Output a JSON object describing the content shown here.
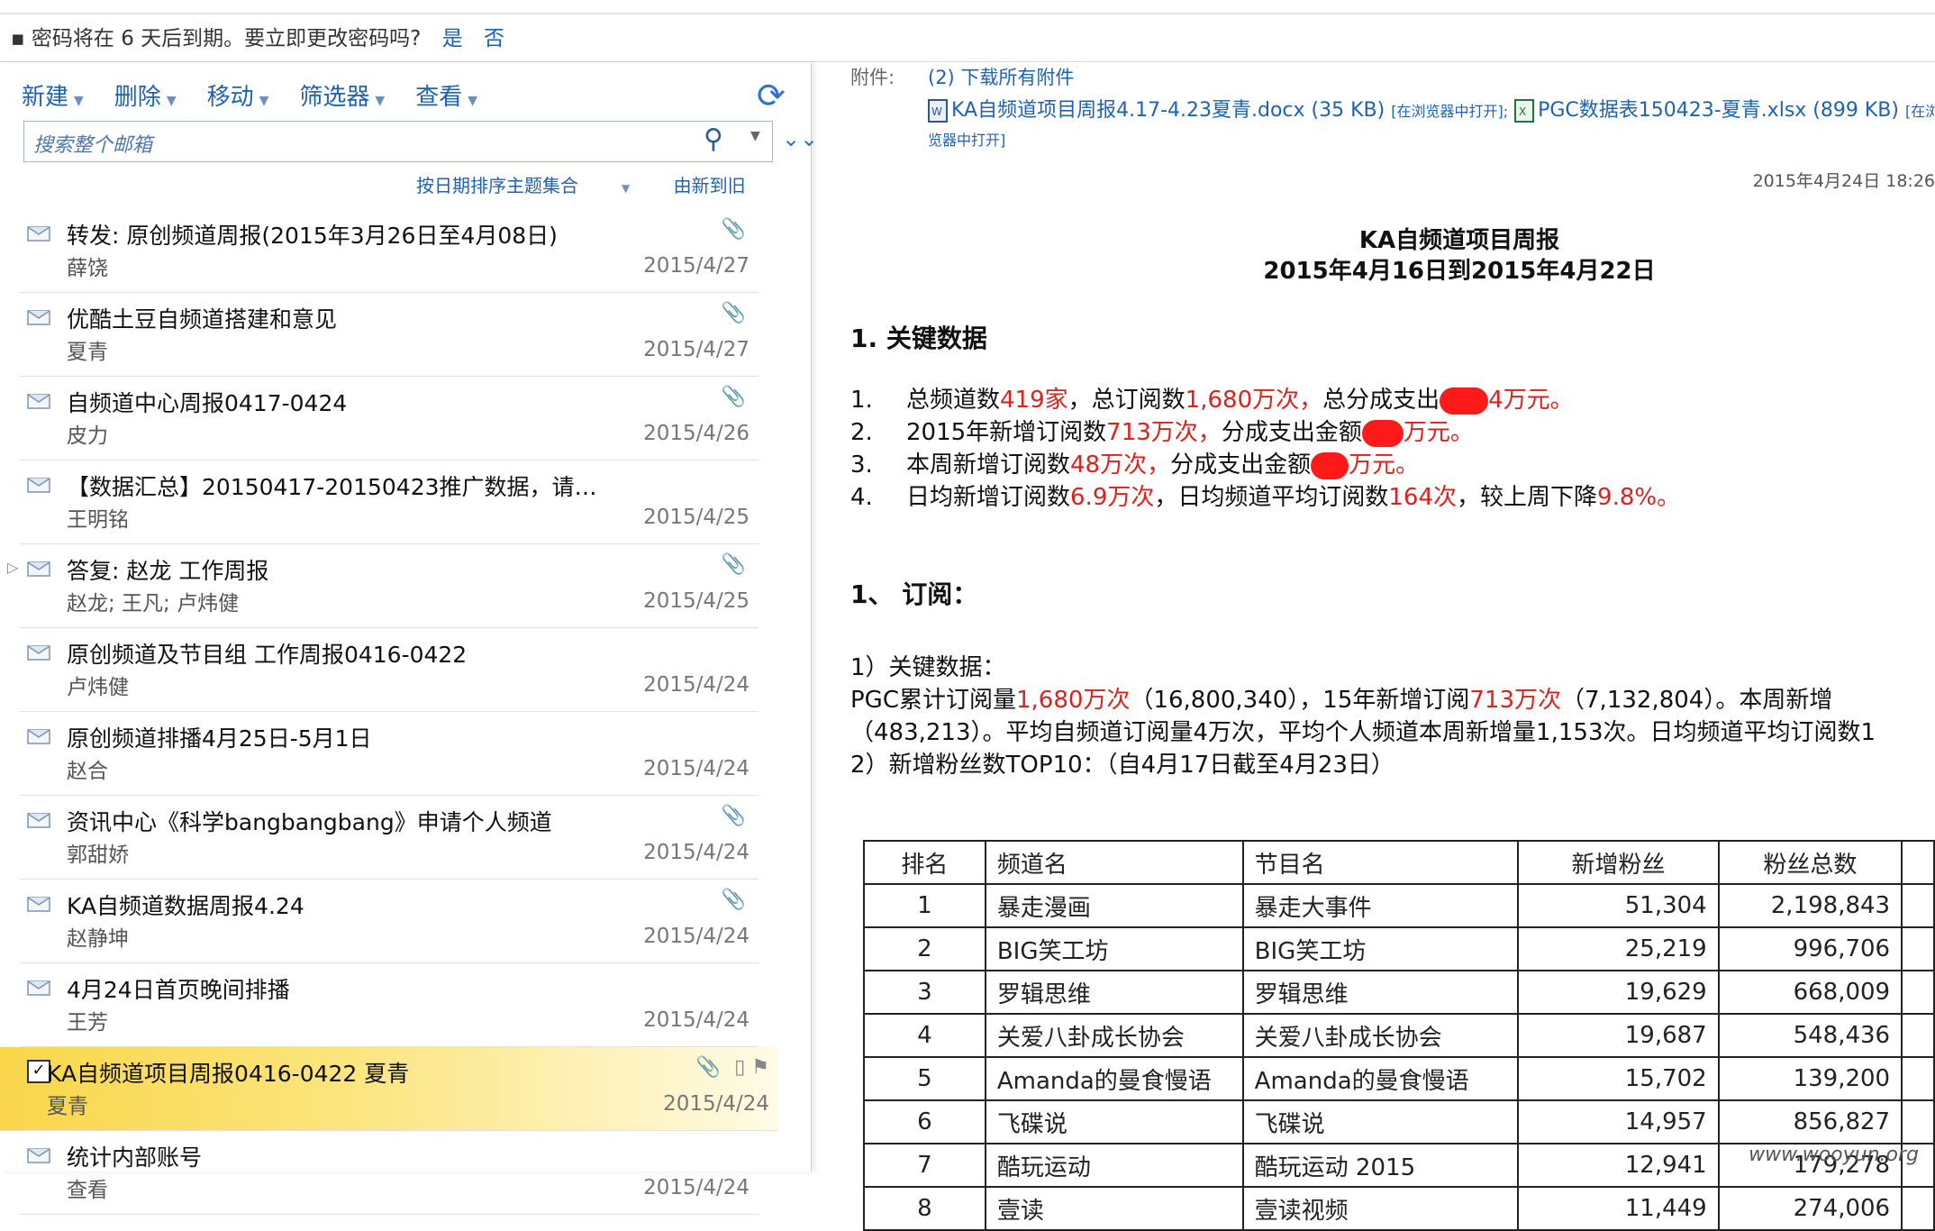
{
  "notice": {
    "text": "密码将在 6 天后到期。要立即更改密码吗?",
    "yes": "是",
    "no": "否"
  },
  "toolbar": {
    "new": "新建",
    "delete": "删除",
    "move": "移动",
    "filter": "筛选器",
    "view": "查看"
  },
  "search": {
    "placeholder": "搜索整个邮箱"
  },
  "sort": {
    "by": "按日期排序主题集合",
    "order": "由新到旧"
  },
  "messages": [
    {
      "subject": "转发: 原创频道周报(2015年3月26日至4月08日)",
      "from": "薛饶",
      "date": "2015/4/27",
      "attach": true
    },
    {
      "subject": "优酷土豆自频道搭建和意见",
      "from": "夏青",
      "date": "2015/4/27",
      "attach": true
    },
    {
      "subject": "自频道中心周报0417-0424",
      "from": "皮力",
      "date": "2015/4/26",
      "attach": true
    },
    {
      "subject": "【数据汇总】20150417-20150423推广数据，请…",
      "from": "王明铭",
      "date": "2015/4/25",
      "attach": false
    },
    {
      "subject": "答复: 赵龙 工作周报",
      "from": "赵龙; 王凡; 卢炜健",
      "date": "2015/4/25",
      "attach": true
    },
    {
      "subject": "原创频道及节目组 工作周报0416-0422",
      "from": "卢炜健",
      "date": "2015/4/24",
      "attach": false
    },
    {
      "subject": "原创频道排播4月25日-5月1日",
      "from": "赵合",
      "date": "2015/4/24",
      "attach": false
    },
    {
      "subject": "资讯中心《科学bangbangbang》申请个人频道",
      "from": "郭甜娇",
      "date": "2015/4/24",
      "attach": true
    },
    {
      "subject": "KA自频道数据周报4.24",
      "from": "赵静坤",
      "date": "2015/4/24",
      "attach": true
    },
    {
      "subject": "4月24日首页晚间排播",
      "from": "王芳",
      "date": "2015/4/24",
      "attach": false
    },
    {
      "subject": "KA自频道项目周报0416-0422 夏青",
      "from": "夏青",
      "date": "2015/4/24",
      "attach": true
    },
    {
      "subject": "统计内部账号",
      "from": "查看",
      "date": "2015/4/24",
      "attach": false
    }
  ],
  "attachments": {
    "label": "附件:",
    "count": "(2)  下载所有附件",
    "file1": "KA自频道项目周报4.17-4.23夏青.docx (35 KB)",
    "open1": "[在浏览器中打开];",
    "file2": "PGC数据表150423-夏青.xlsx (899 KB)",
    "open2a": "[在浏",
    "open2b": "览器中打开]"
  },
  "message_date": "2015年4月24日 18:26",
  "report": {
    "title": "KA自频道项目周报",
    "subtitle": "2015年4月16日到2015年4月22日",
    "h1": "1.   关键数据",
    "kd": [
      {
        "n": "1.",
        "a": "总频道数",
        "b": "419家",
        "c": "，总订阅数",
        "d": "1,680万次，",
        "e": "总分成支出",
        "f": "4万元。"
      },
      {
        "n": "2.",
        "a": "2015年新增订阅数",
        "b": "713万次，",
        "c": "分成支出金额",
        "d": "万元。"
      },
      {
        "n": "3.",
        "a": "本周新增订阅数",
        "b": "48万次，",
        "c": "分成支出金额",
        "d": "万元。"
      },
      {
        "n": "4.",
        "a": "日均新增订阅数",
        "b": "6.9万次",
        "c": "，日均频道平均订阅数",
        "d": "164次",
        "e": "，较上周下降",
        "f": "9.8%。"
      }
    ],
    "h2": "1、 订阅：",
    "p1": "1）关键数据：",
    "p2a": "PGC累计订阅量",
    "p2b": "1,680万次",
    "p2c": "（16,800,340），15年新增订阅",
    "p2d": "713万次",
    "p2e": "（7,132,804）。本周新增",
    "p3": "（483,213）。平均自频道订阅量4万次，平均个人频道本周新增量1,153次。日均频道平均订阅数1",
    "p4": "2）新增粉丝数TOP10：（自4月17日截至4月23日）"
  },
  "table": {
    "headers": [
      "排名",
      "频道名",
      "节目名",
      "新增粉丝",
      "粉丝总数"
    ],
    "rows": [
      [
        "1",
        "暴走漫画",
        "暴走大事件",
        "51,304",
        "2,198,843"
      ],
      [
        "2",
        "BIG笑工坊",
        "BIG笑工坊",
        "25,219",
        "996,706"
      ],
      [
        "3",
        "罗辑思维",
        "罗辑思维",
        "19,629",
        "668,009"
      ],
      [
        "4",
        "关爱八卦成长协会",
        "关爱八卦成长协会",
        "19,687",
        "548,436"
      ],
      [
        "5",
        "Amanda的曼食慢语",
        "Amanda的曼食慢语",
        "15,702",
        "139,200"
      ],
      [
        "6",
        "飞碟说",
        "飞碟说",
        "14,957",
        "856,827"
      ],
      [
        "7",
        "酷玩运动",
        "酷玩运动 2015",
        "12,941",
        "179,278"
      ],
      [
        "8",
        "壹读",
        "壹读视频",
        "11,449",
        "274,006"
      ]
    ]
  },
  "watermark": "www.wooyun.org",
  "colors": {
    "link": "#1e62b4",
    "highlight": "#e0201b",
    "selected": "#f9d64a"
  }
}
